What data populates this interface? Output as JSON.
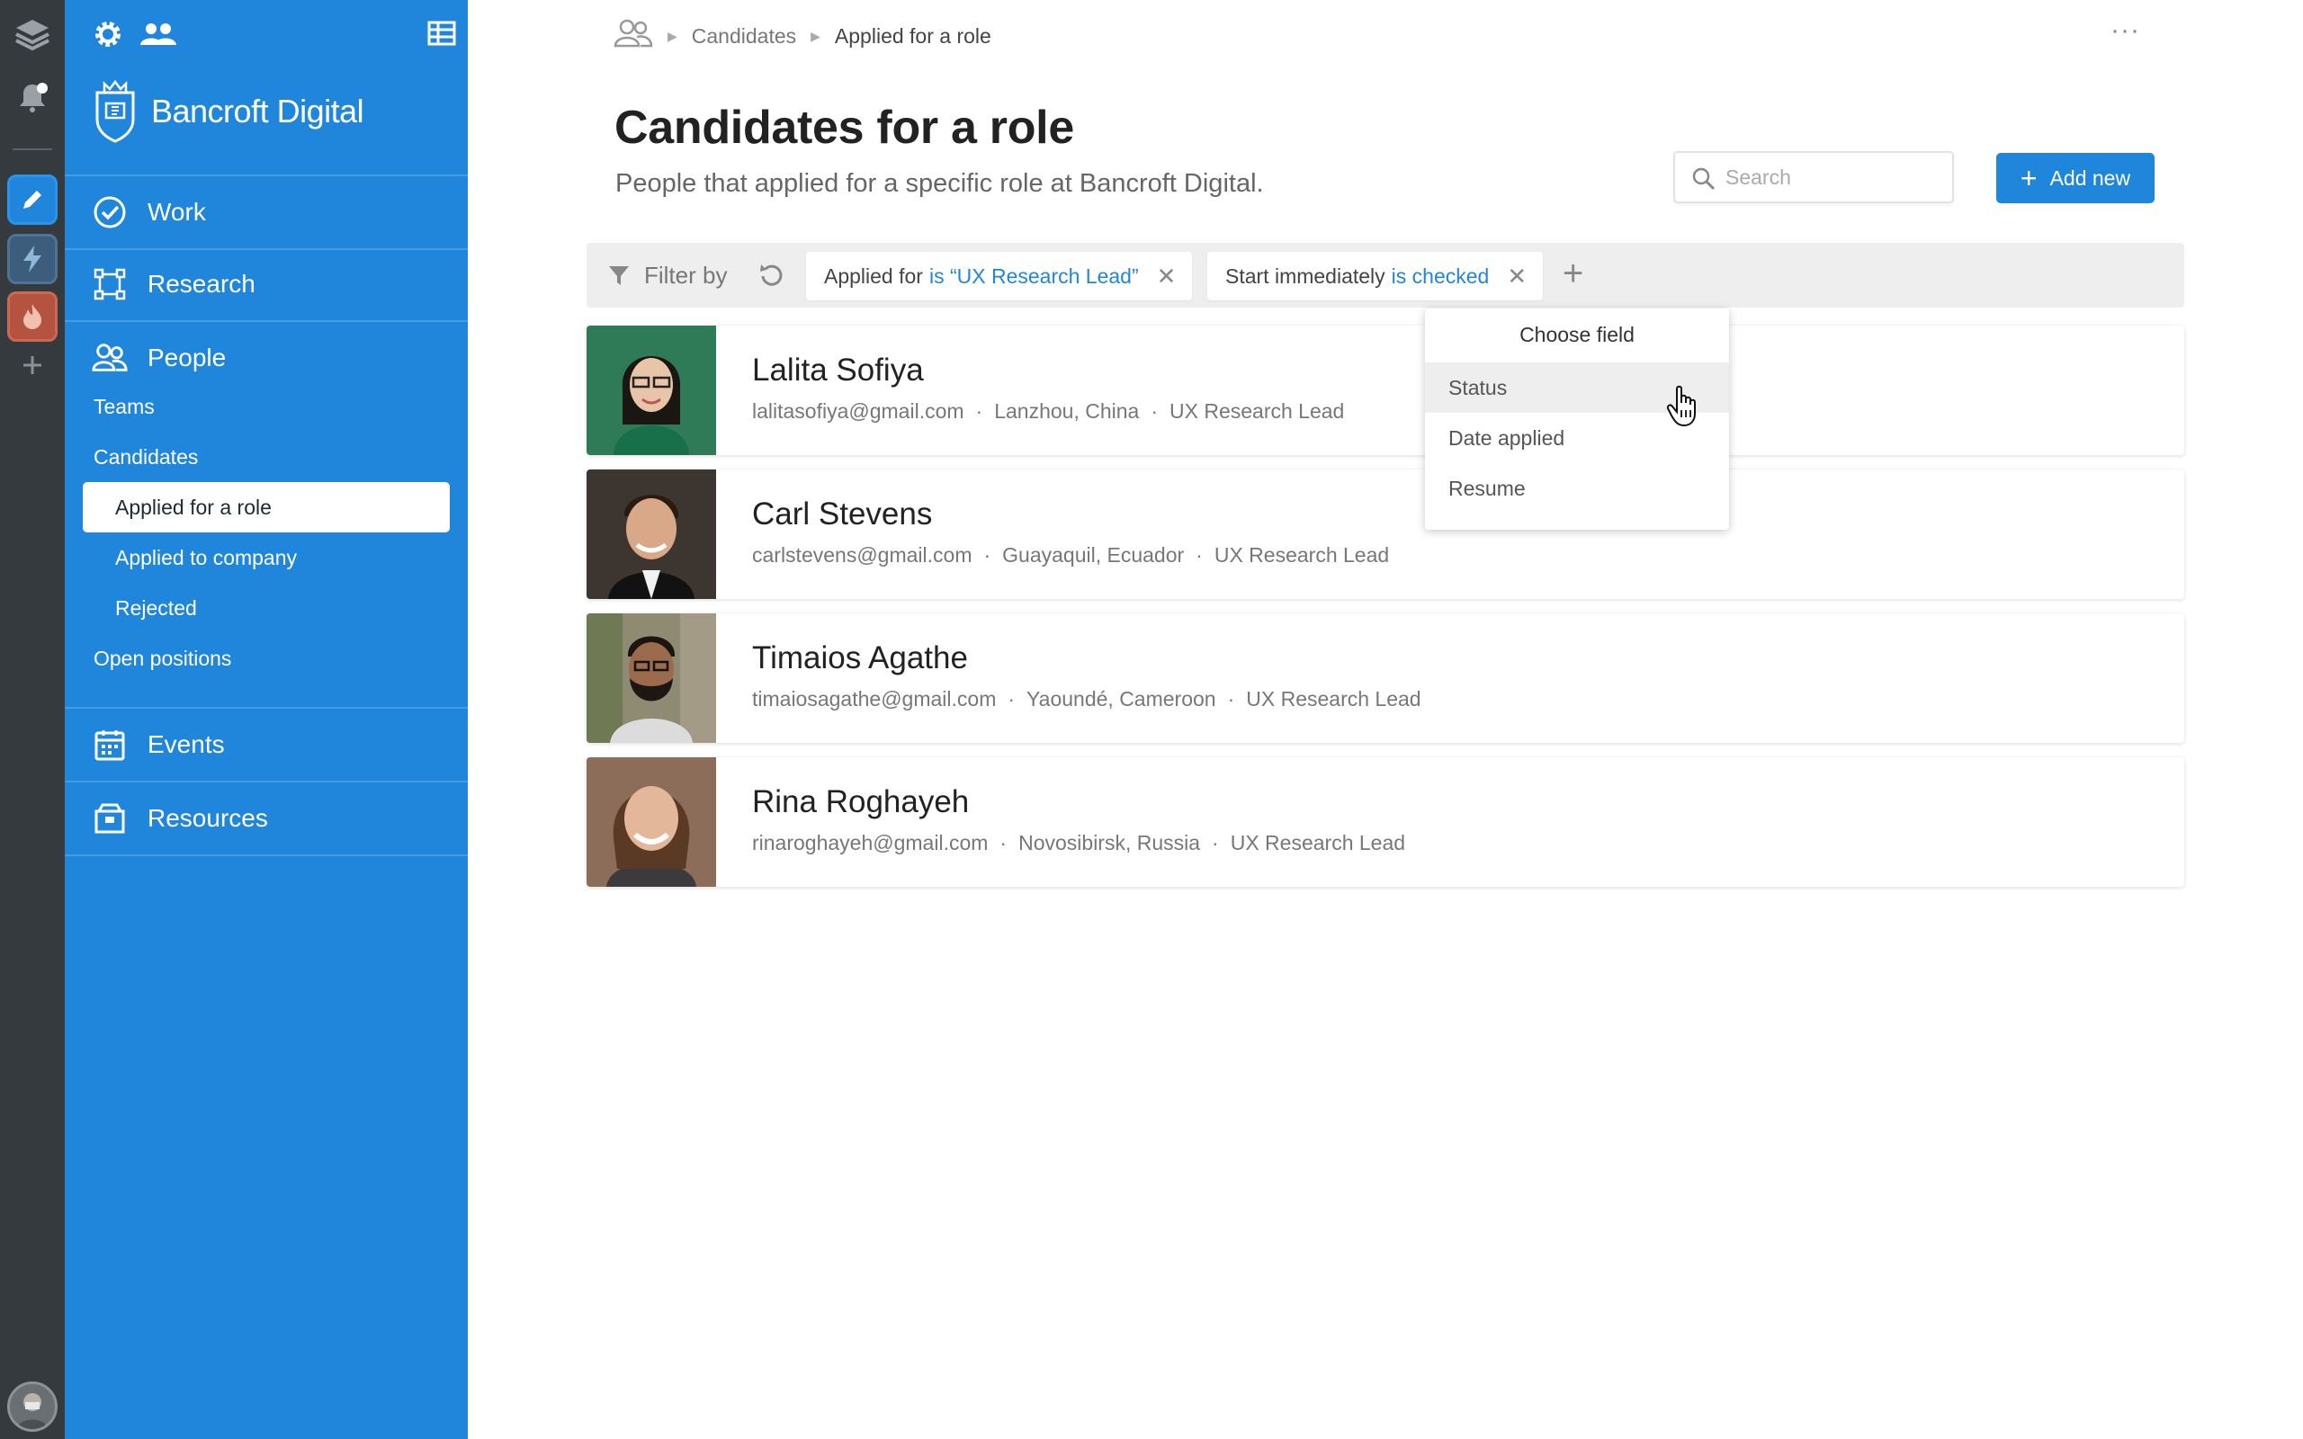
{
  "brand": {
    "name": "Bancroft Digital",
    "accent": "#1f86dc",
    "rail_bg": "#353a3f"
  },
  "nav": {
    "work": "Work",
    "research": "Research",
    "people": "People",
    "people_sub": {
      "teams": "Teams",
      "candidates": "Candidates",
      "applied_role": "Applied for a role",
      "applied_company": "Applied to company",
      "rejected": "Rejected",
      "open_positions": "Open positions"
    },
    "events": "Events",
    "resources": "Resources"
  },
  "breadcrumb": {
    "section": "Candidates",
    "current": "Applied for a role"
  },
  "header": {
    "title": "Candidates for a role",
    "subtitle": "People that applied for a specific role at Bancroft Digital.",
    "search_placeholder": "Search",
    "add_label": "Add new"
  },
  "filter": {
    "label": "Filter by",
    "chips": [
      {
        "field": "Applied for",
        "condition": "is “UX Research Lead”"
      },
      {
        "field": "Start immediately",
        "condition": "is checked"
      }
    ]
  },
  "dropdown": {
    "title": "Choose field",
    "items": [
      "Status",
      "Date applied",
      "Resume"
    ]
  },
  "candidates": [
    {
      "name": "Lalita Sofiya",
      "email": "lalitasofiya@gmail.com",
      "location": "Lanzhou, China",
      "role": "UX Research Lead"
    },
    {
      "name": "Carl Stevens",
      "email": "carlstevens@gmail.com",
      "location": "Guayaquil, Ecuador",
      "role": "UX Research Lead"
    },
    {
      "name": "Timaios Agathe",
      "email": "timaiosagathe@gmail.com",
      "location": "Yaoundé, Cameroon",
      "role": "UX Research Lead"
    },
    {
      "name": "Rina Roghayeh",
      "email": "rinaroghayeh@gmail.com",
      "location": "Novosibirsk, Russia",
      "role": "UX Research Lead"
    }
  ]
}
